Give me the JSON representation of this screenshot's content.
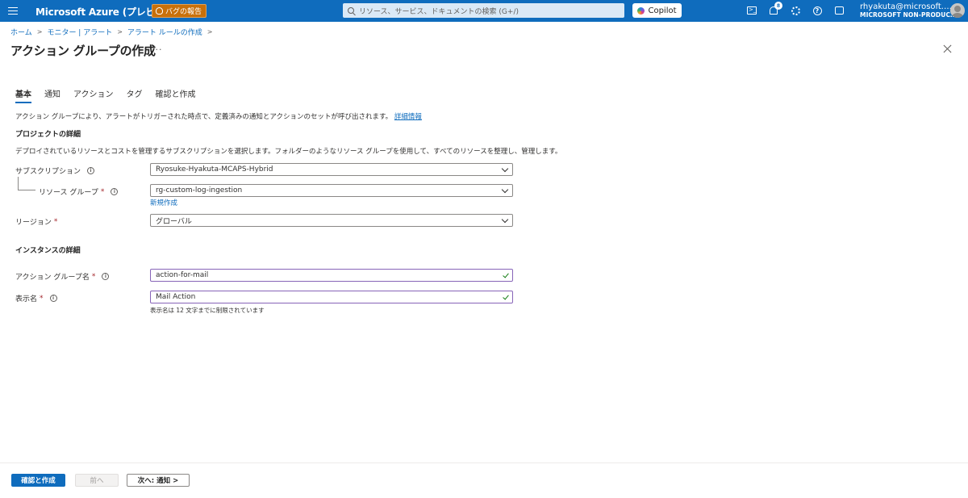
{
  "topbar": {
    "brand": "Microsoft Azure (プレビュー)",
    "bug_report": "バグの報告",
    "search_placeholder": "リソース、サービス、ドキュメントの検索 (G+/)",
    "copilot": "Copilot",
    "notification_count": "8",
    "account_email": "rhyakuta@microsoft.…",
    "account_tenant": "MICROSOFT NON-PRODUC…"
  },
  "breadcrumb": [
    "ホーム",
    "モニター | アラート",
    "アラート ルールの作成"
  ],
  "page": {
    "title": "アクション グループの作成",
    "more": "···"
  },
  "tabs": [
    "基本",
    "通知",
    "アクション",
    "タグ",
    "確認と作成"
  ],
  "intro": {
    "text": "アクション グループにより、アラートがトリガーされた時点で、定義済みの通知とアクションのセットが呼び出されます。",
    "link": "詳細情報"
  },
  "project": {
    "heading": "プロジェクトの詳細",
    "description": "デプロイされているリソースとコストを管理するサブスクリプションを選択します。フォルダーのようなリソース グループを使用して、すべてのリソースを整理し、管理します。",
    "subscription_label": "サブスクリプション",
    "subscription_value": "Ryosuke-Hyakuta-MCAPS-Hybrid",
    "resource_group_label": "リソース グループ",
    "resource_group_value": "rg-custom-log-ingestion",
    "create_new": "新規作成",
    "region_label": "リージョン",
    "region_value": "グローバル"
  },
  "instance": {
    "heading": "インスタンスの詳細",
    "action_group_name_label": "アクション グループ名",
    "action_group_name_value": "action-for-mail",
    "display_name_label": "表示名",
    "display_name_value": "Mail Action",
    "display_name_hint": "表示名は 12 文字までに制限されています"
  },
  "required_mark": "*",
  "info_glyph": "i",
  "footer": {
    "review_create": "確認と作成",
    "previous": "前へ",
    "next": "次へ: 通知 >"
  },
  "colors": {
    "topbar": "#0f6cbd",
    "bug_button": "#c8700a",
    "primary": "#0f6cbd",
    "valid_border": "#8764b8",
    "valid_check": "#107c10",
    "required": "#a4262c"
  }
}
